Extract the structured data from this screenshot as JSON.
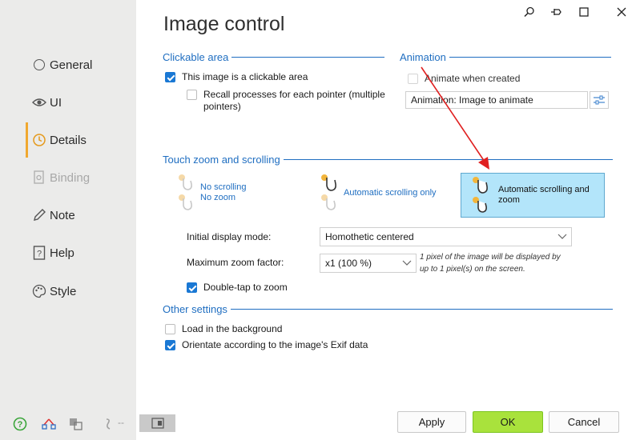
{
  "title": "Image control",
  "sidebar": {
    "items": [
      {
        "label": "General"
      },
      {
        "label": "UI"
      },
      {
        "label": "Details"
      },
      {
        "label": "Binding"
      },
      {
        "label": "Note"
      },
      {
        "label": "Help"
      },
      {
        "label": "Style"
      }
    ],
    "bottom_dash": "--"
  },
  "clickable": {
    "header": "Clickable area",
    "is_clickable_label": "This image is a clickable area",
    "is_clickable_checked": true,
    "recall_label_1": "Recall processes for each pointer (multiple",
    "recall_label_2": "pointers)",
    "recall_checked": false
  },
  "animation": {
    "header": "Animation",
    "animate_label": "Animate when created",
    "animate_checked": false,
    "field_value": "Animation: Image to animate"
  },
  "touch": {
    "header": "Touch zoom and scrolling",
    "options": [
      {
        "line1": "No scrolling",
        "line2": "No zoom"
      },
      {
        "line1": "Automatic scrolling only"
      },
      {
        "line1": "Automatic scrolling and",
        "line2": "zoom"
      }
    ],
    "initial_display_label": "Initial display mode:",
    "initial_display_value": "Homothetic centered",
    "max_zoom_label": "Maximum zoom factor:",
    "max_zoom_value": "x1 (100 %)",
    "zoom_note_1": "1 pixel of the image will be displayed by",
    "zoom_note_2": "up to 1 pixel(s) on the screen.",
    "double_tap_label": "Double-tap to zoom",
    "double_tap_checked": true
  },
  "other": {
    "header": "Other settings",
    "load_bg_label": "Load in the background",
    "load_bg_checked": false,
    "exif_label": "Orientate according to the image's Exif data",
    "exif_checked": true
  },
  "buttons": {
    "apply": "Apply",
    "ok": "OK",
    "cancel": "Cancel"
  },
  "colors": {
    "accent_blue": "#1f6ec1",
    "ok_green": "#a9e23c",
    "selected_option": "#b3e5fa",
    "active_marker": "#f0a830",
    "annotation_arrow": "#e02020"
  }
}
